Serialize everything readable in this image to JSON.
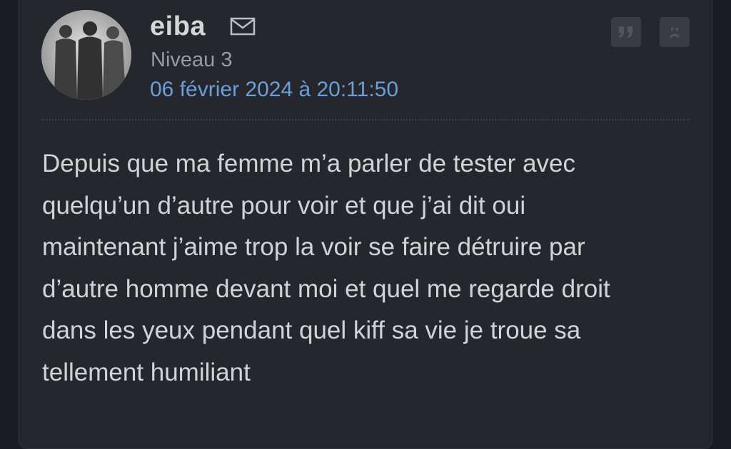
{
  "post": {
    "author": "eiba",
    "level": "Niveau 3",
    "date": "06 février 2024 à 20:11:50",
    "message_lines": [
      "Depuis que ma femme m’a parler de tester avec",
      "quelqu’un d’autre pour voir et que j’ai dit oui",
      "maintenant j’aime trop la voir se faire détruire par",
      "d’autre homme devant moi et quel me regarde droit",
      "dans les yeux pendant quel kiff sa vie je troue sa",
      "tellement humiliant"
    ]
  },
  "icons": {
    "mail": "envelope-icon",
    "quote": "quote-icon",
    "report": "sad-face-icon"
  },
  "colors": {
    "background": "#1b1c21",
    "card": "#26272d",
    "author": "#d6d6d6",
    "level": "#9a9ba0",
    "date_link": "#6a9fd8",
    "message_text": "#d2d3d6",
    "action_button": "#3b3c42"
  }
}
